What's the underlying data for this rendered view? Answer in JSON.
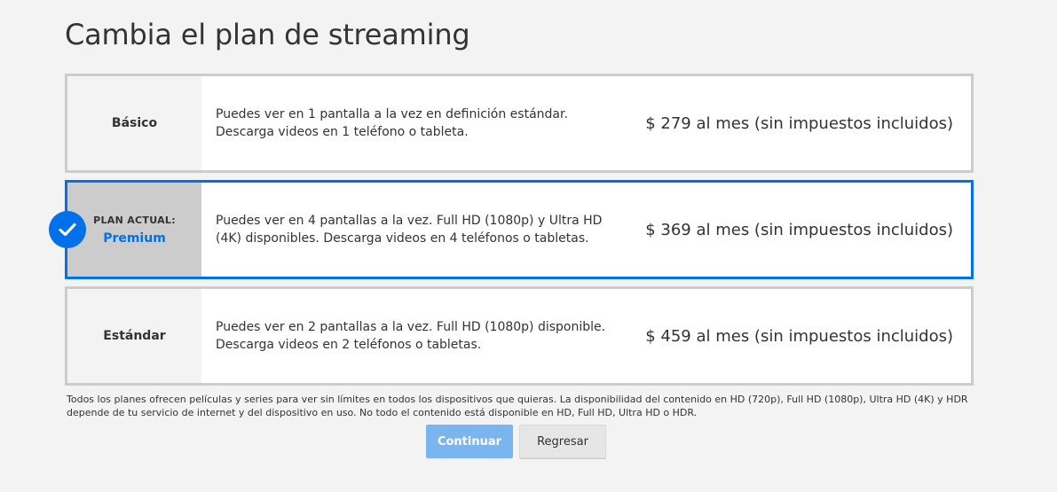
{
  "page": {
    "title": "Cambia el plan de streaming"
  },
  "plans": [
    {
      "name": "Básico",
      "description_line1": "Puedes ver en 1 pantalla a la vez en definición estándar.",
      "description_line2": "Descarga videos en 1 teléfono o tableta.",
      "price": "$ 279 al mes (sin impuestos incluidos)",
      "current": false
    },
    {
      "current_label": "PLAN ACTUAL:",
      "name": "Premium",
      "description_line1": "Puedes ver en 4 pantallas a la vez. Full HD (1080p) y Ultra HD",
      "description_line2": "(4K) disponibles. Descarga videos en 4 teléfonos o tabletas.",
      "price": "$ 369 al mes (sin impuestos incluidos)",
      "current": true,
      "icon": "check-icon"
    },
    {
      "name": "Estándar",
      "description_line1": "Puedes ver en 2 pantallas a la vez. Full HD (1080p) disponible.",
      "description_line2": "Descarga videos en 2 teléfonos o tabletas.",
      "price": "$ 459 al mes (sin impuestos incluidos)",
      "current": false
    }
  ],
  "disclaimer": {
    "line1": "Todos los planes ofrecen películas y series para ver sin límites en todos los dispositivos que quieras. La disponibilidad del contenido en HD (720p), Full HD (1080p), Ultra HD (4K) y HDR",
    "line2": "depende de tu servicio de internet y del dispositivo en uso. No todo el contenido está disponible en HD, Full HD, Ultra HD o HDR."
  },
  "buttons": {
    "continue_label": "Continuar",
    "back_label": "Regresar"
  },
  "colors": {
    "accent": "#0071eb",
    "continue_button": "#7ab5f0",
    "background": "#f3f3f3",
    "card_border": "#cccccc"
  }
}
